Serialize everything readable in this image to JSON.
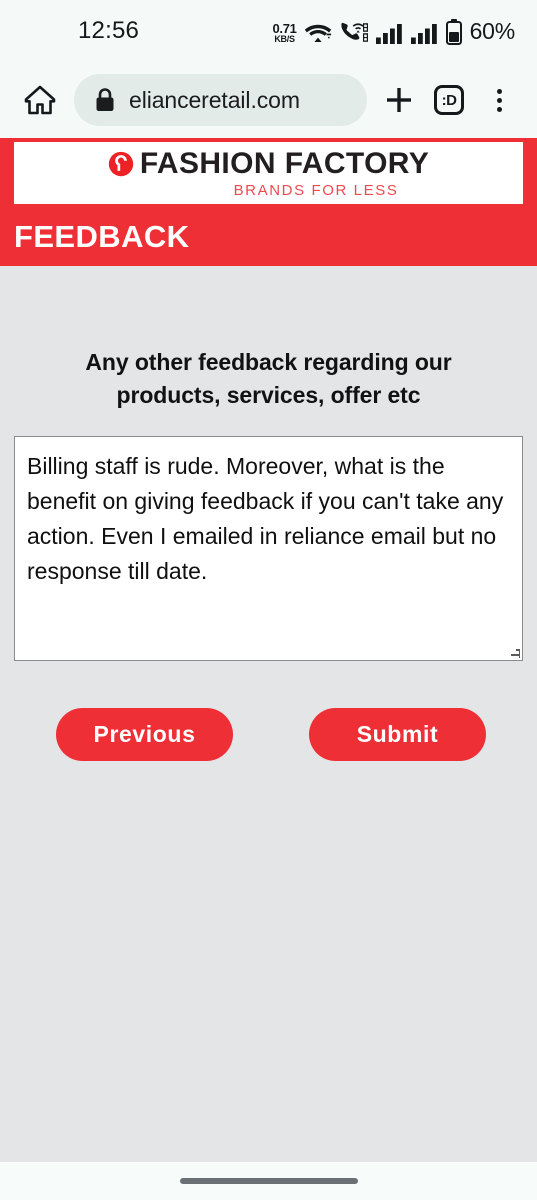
{
  "status_bar": {
    "time": "12:56",
    "network_rate": "0.71",
    "network_unit": "KB/S",
    "wifi_icon": "wifi-icon",
    "call_icon": "volte-call-icon",
    "signal_icon_1": "signal-bars-sim1-icon",
    "signal_icon_2": "signal-bars-sim2-icon",
    "battery_icon": "battery-icon",
    "battery_percent": "60%"
  },
  "browser": {
    "home_icon": "home-icon",
    "lock_icon": "lock-icon",
    "url": "elianceretail.com",
    "new_tab_icon": "plus-icon",
    "tab_counter_label": ":D",
    "menu_icon": "overflow-menu-icon"
  },
  "site": {
    "logo_mark": "fashion-factory-logo-mark",
    "logo_text": "FASHION FACTORY",
    "logo_tagline": "BRANDS FOR LESS",
    "header_title": "FEEDBACK"
  },
  "form": {
    "question": "Any other feedback regarding our products, services, offer etc",
    "feedback_value": "Billing staff is rude. Moreover, what is the benefit on giving feedback if you can't take any action. Even I emailed in reliance email but no response till date.",
    "feedback_placeholder": "",
    "previous_label": "Previous",
    "submit_label": "Submit"
  },
  "system_nav": {
    "gesture_pill": "home-gesture-pill"
  },
  "colors": {
    "brand_red": "#ee2f35",
    "page_background": "#e4e5e6",
    "toolbar_background": "#f5f9f8",
    "url_pill": "#e3ebe8"
  }
}
